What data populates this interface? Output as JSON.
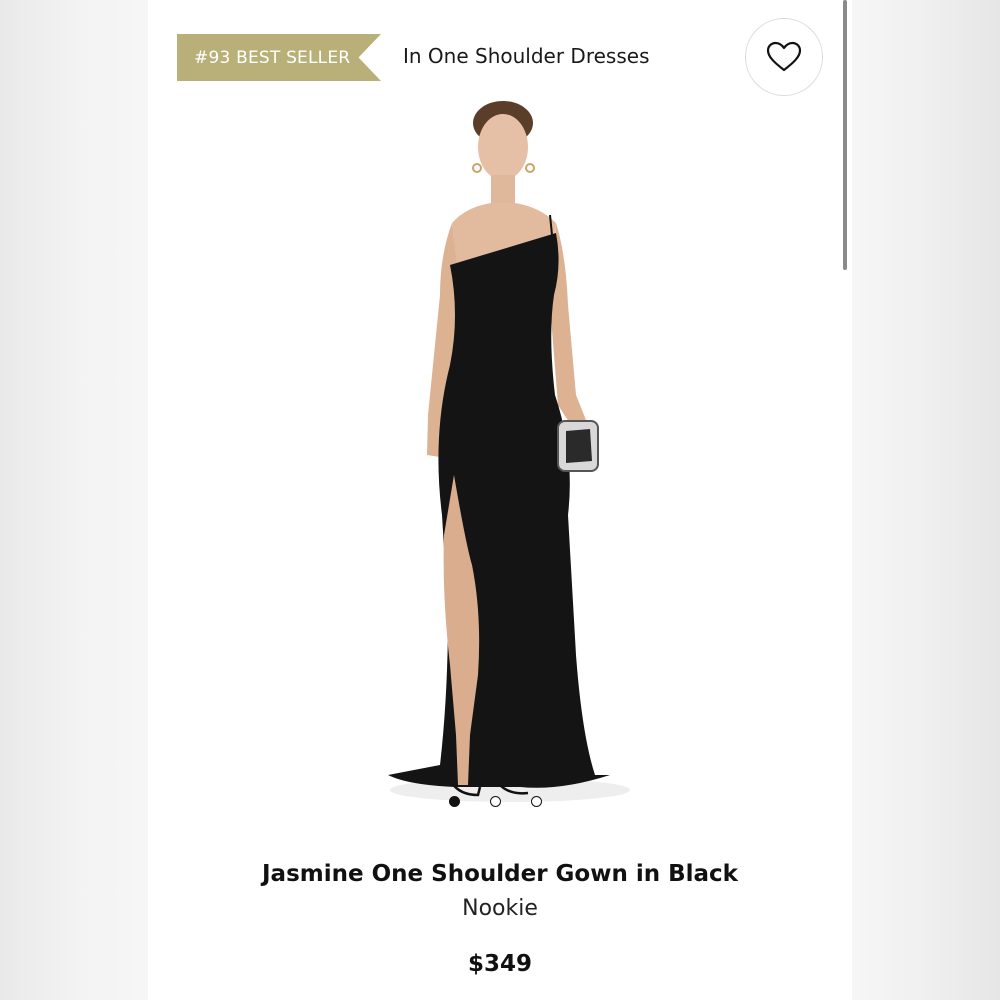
{
  "badge": {
    "label": "#93 BEST SELLER",
    "color": "#b9b079"
  },
  "category": {
    "label": "In One Shoulder Dresses"
  },
  "favorite": {
    "icon": "heart-outline-icon"
  },
  "gallery": {
    "image_count": 3,
    "active_index": 0
  },
  "product": {
    "title": "Jasmine One Shoulder Gown in Black",
    "brand": "Nookie",
    "price": "$349"
  }
}
